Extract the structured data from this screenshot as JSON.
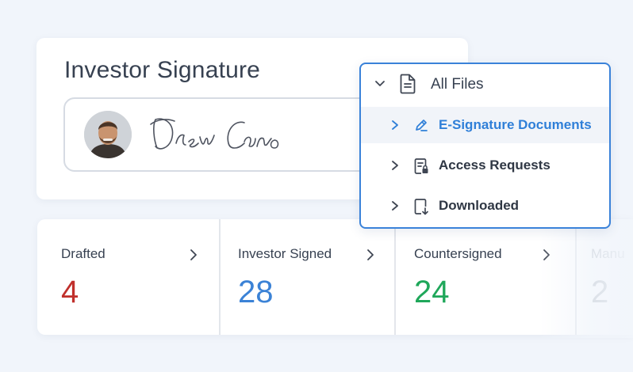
{
  "signature_card": {
    "title": "Investor Signature",
    "signer_name": "Drew Cano"
  },
  "dropdown": {
    "header_label": "All Files",
    "items": [
      {
        "label": "E-Signature Documents",
        "icon": "pen-icon",
        "active": true
      },
      {
        "label": "Access Requests",
        "icon": "document-lock-icon",
        "active": false
      },
      {
        "label": "Downloaded",
        "icon": "file-download-icon",
        "active": false
      }
    ]
  },
  "stats": [
    {
      "label": "Drafted",
      "value": "4",
      "color": "#c0302c"
    },
    {
      "label": "Investor Signed",
      "value": "28",
      "color": "#3b82d6"
    },
    {
      "label": "Countersigned",
      "value": "24",
      "color": "#1fa75a"
    },
    {
      "label": "Manu",
      "value": "2",
      "color": "#9aa3ad"
    }
  ],
  "colors": {
    "accent": "#3a82d9",
    "background": "#f1f5fb"
  }
}
